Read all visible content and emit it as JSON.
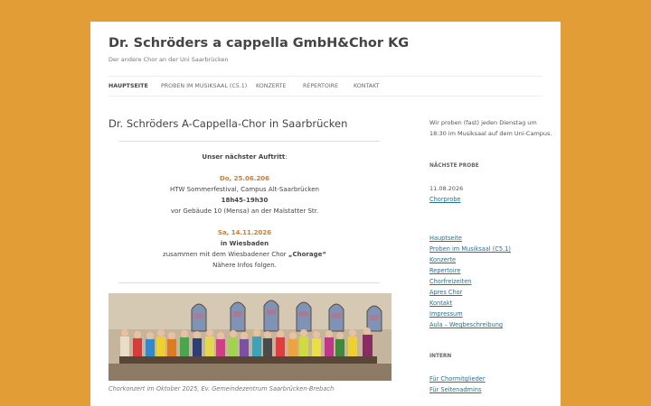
{
  "site": {
    "title": "Dr. Schröders a cappella GmbH&Chor KG",
    "description": "Der andere Chor an der Uni Saarbrücken"
  },
  "nav": [
    {
      "label": "Hauptseite",
      "active": true
    },
    {
      "label": "Proben im Musiksaal (C5.1)",
      "active": false
    },
    {
      "label": "Konzerte",
      "active": false
    },
    {
      "label": "Repertoire",
      "active": false
    },
    {
      "label": "Kontakt",
      "active": false
    }
  ],
  "main": {
    "title": "Dr. Schröders A-Cappella-Chor in Saarbrücken",
    "next_heading": "Unser nächster Auftritt",
    "next_heading_colon": ":",
    "event1": {
      "date": "Do, 25.06.206",
      "line1": "HTW Sommerfestival, Campus Alt-Saarbrücken",
      "time": "18h45-19h30",
      "line2": "vor Gebäude 10 (Mensa) an der Malstatter Str."
    },
    "event2": {
      "date": "Sa, 14.11.2026",
      "place": "in Wiesbaden",
      "line1_pre": "zusammen mit dem Wiesbadener Chor ",
      "line1_bold": "„Chorage“",
      "line2": "Nähere Infos folgen."
    },
    "caption": "Chorkonzert im Oktober 2025, Ev. Gemeindezentrum Saarbrücken-Brebach"
  },
  "sidebar": {
    "intro_line1": "Wir proben (fast) jeden Dienstag um",
    "intro_line2": "18:30 im Musiksaal auf dem Uni-Campus.",
    "next_heading": "Nächste Probe",
    "next_date": "11.08.2026",
    "next_link": "Chorprobe",
    "links": [
      "Hauptseite",
      "Proben im Musiksaal (C5.1)",
      "Konzerte",
      "Repertoire",
      "Chorfreizeiten",
      "Apres Chor",
      "Kontakt",
      "Impressum",
      "Aula – Wegbeschreibung"
    ],
    "intern_heading": "Intern",
    "intern_links": [
      "Für Chormitglieder",
      "Für Seitenadmins"
    ]
  },
  "colors": {
    "background": "#e29d37",
    "accent_date": "#e07a1e",
    "link": "#21759b"
  }
}
